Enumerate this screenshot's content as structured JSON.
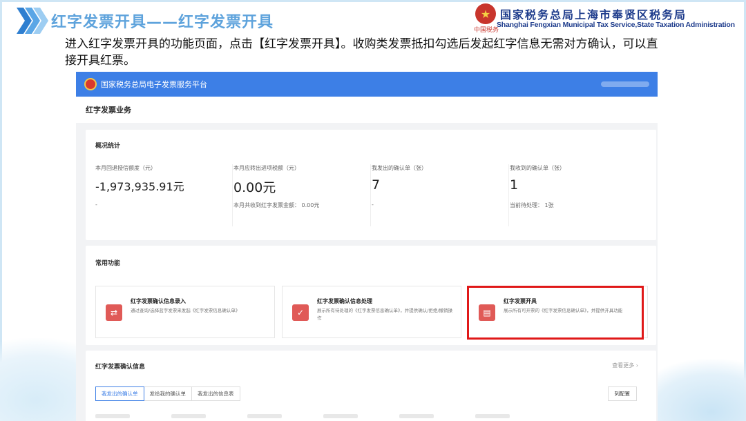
{
  "slide": {
    "title": "红字发票开具——红字发票开具",
    "org_cn": "国家税务总局上海市奉贤区税务局",
    "org_en": "Shanghai Fengxian Municipal Tax Service,State Taxation Administration",
    "emblem_sub": "中国税务",
    "instruction": "进入红字发票开具的功能页面，点击【红字发票开具】。收购类发票抵扣勾选后发起红字信息无需对方确认，可以直接开具红票。",
    "colors": {
      "title": "#5ea3dc",
      "org": "#1e3c8c",
      "highlight": "#e01818",
      "topbar": "#3d7fe6"
    }
  },
  "app": {
    "platform_title": "国家税务总局电子发票服务平台",
    "page_title": "红字发票业务",
    "stats": {
      "title": "概况统计",
      "items": [
        {
          "label": "本月回退授信额度（元）",
          "value": "-1,973,935.91元",
          "note": "-"
        },
        {
          "label": "本月应转出进项税额（元）",
          "value": "0.00元",
          "note": "本月共收到红字发票金额： 0.00元"
        },
        {
          "label": "我发出的确认单（张）",
          "value": "7",
          "note": "-"
        },
        {
          "label": "我收到的确认单（张）",
          "value": "1",
          "note": "当前待处理： 1张"
        }
      ]
    },
    "functions": {
      "title": "常用功能",
      "items": [
        {
          "name": "红字发票确认信息录入",
          "desc": "通过查询/选择蓝字发票来发起《红字发票信息确认单》",
          "icon": "transfer-icon"
        },
        {
          "name": "红字发票确认信息处理",
          "desc": "展示所有待处理的《红字发票信息确认单》，并提供确认/拒绝/撤销操作",
          "icon": "check-doc-icon"
        },
        {
          "name": "红字发票开具",
          "desc": "展示所有可开票的《红字发票信息确认单》，并提供开具功能",
          "icon": "invoice-icon"
        }
      ]
    },
    "info": {
      "title": "红字发票确认信息",
      "more": "查看更多 ›",
      "tabs": [
        "我发出的确认单",
        "发给我的确认单",
        "我发出的信息表"
      ],
      "active_tab": "我发出的确认单",
      "col_config": "列配置"
    }
  }
}
